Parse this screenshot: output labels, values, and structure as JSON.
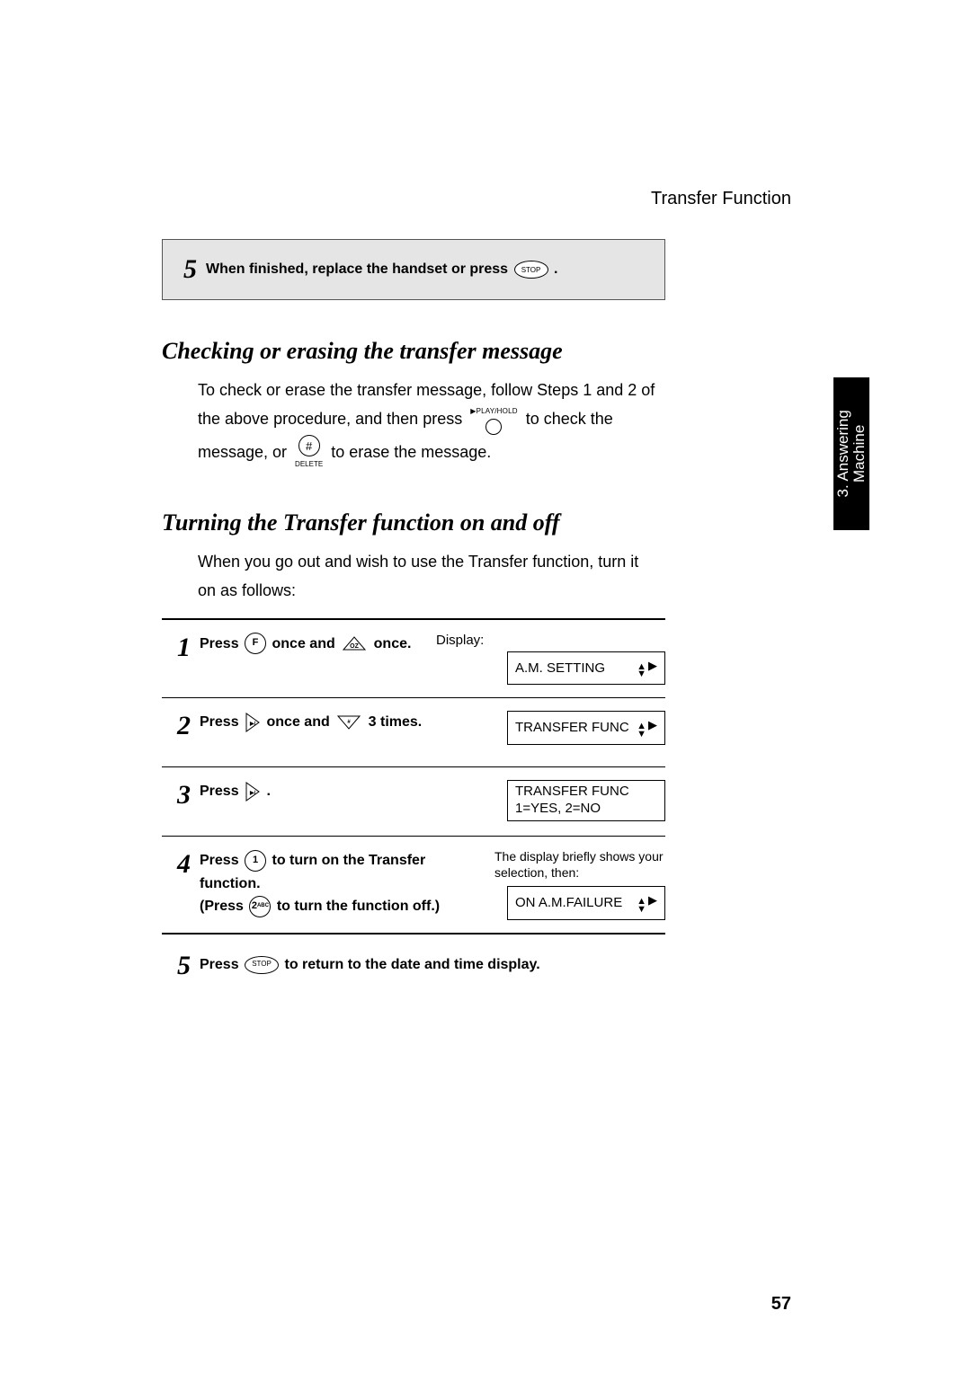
{
  "header": {
    "title": "Transfer Function"
  },
  "sideTab": {
    "line1": "3. Answering",
    "line2": "Machine"
  },
  "pageNumber": "57",
  "keys": {
    "stop": "STOP",
    "playHold": "PLAY/HOLD",
    "hashSymbol": "#",
    "hashLabel": "DELETE",
    "f": "F",
    "one": "1",
    "twoSub": "ABC",
    "upSub": "OZ",
    "downSub": "#"
  },
  "topStep": {
    "num": "5",
    "textA": "When finished, replace the handset or press ",
    "textB": "."
  },
  "section1": {
    "title": "Checking or erasing the transfer message",
    "p1a": "To check or erase the transfer message, follow Steps 1 and 2 of the above procedure, and then press ",
    "p1b": " to check the message, or ",
    "p1c": " to erase the message."
  },
  "section2": {
    "title": "Turning the Transfer function on and off",
    "intro": "When you go out and wish to use the Transfer function, turn it on as follows:",
    "steps": [
      {
        "num": "1",
        "a": "Press ",
        "b": " once and ",
        "c": " once.",
        "displayLabel": "Display:",
        "lcd": "A.M. SETTING"
      },
      {
        "num": "2",
        "a": "Press ",
        "b": " once and ",
        "c": " 3 times.",
        "lcd": "TRANSFER FUNC"
      },
      {
        "num": "3",
        "a": "Press ",
        "b": ".",
        "lcdLine1": "TRANSFER FUNC",
        "lcdLine2": "1=YES, 2=NO"
      },
      {
        "num": "4",
        "a": "Press ",
        "b": " to turn on the Transfer function.",
        "c": "(Press ",
        "d": " to turn the function off.)",
        "note": "The display briefly shows your selection, then:",
        "lcd": "ON A.M.FAILURE"
      },
      {
        "num": "5",
        "a": "Press ",
        "b": " to return to the date and time display."
      }
    ]
  }
}
